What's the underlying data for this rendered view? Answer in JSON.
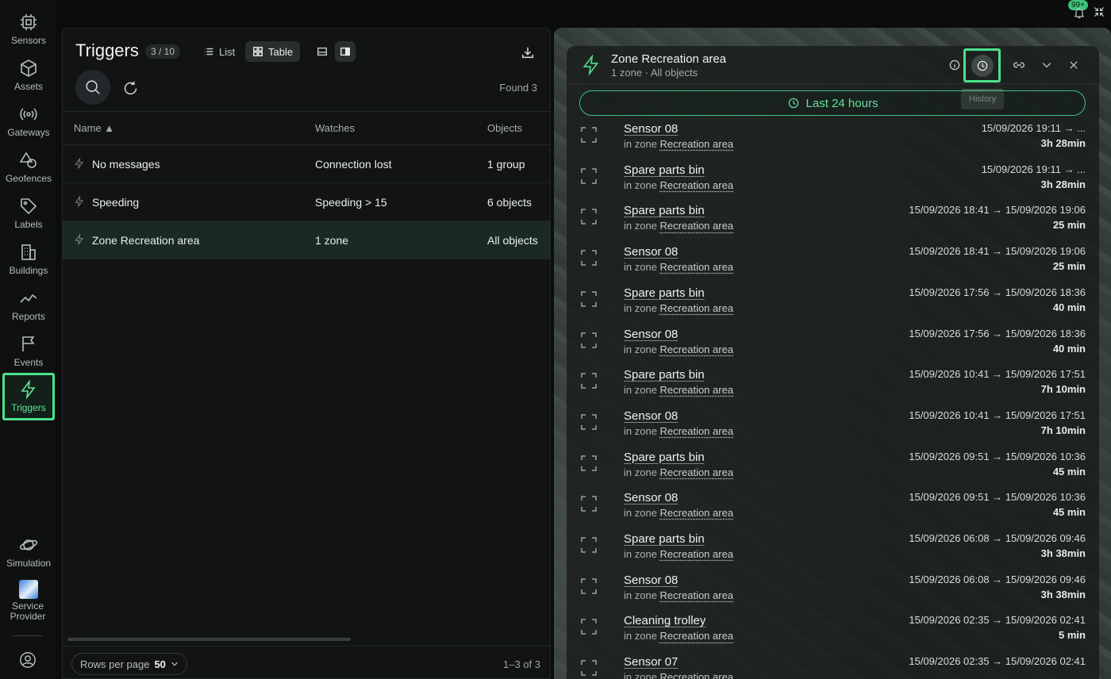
{
  "nav": {
    "items": [
      {
        "label": "Sensors",
        "icon": "chip-icon"
      },
      {
        "label": "Assets",
        "icon": "cube-icon"
      },
      {
        "label": "Gateways",
        "icon": "broadcast-icon"
      },
      {
        "label": "Geofences",
        "icon": "shapes-icon"
      },
      {
        "label": "Labels",
        "icon": "tag-icon"
      },
      {
        "label": "Buildings",
        "icon": "building-icon"
      },
      {
        "label": "Reports",
        "icon": "chart-line-icon"
      },
      {
        "label": "Events",
        "icon": "flag-icon"
      },
      {
        "label": "Triggers",
        "icon": "bolt-icon"
      }
    ],
    "bottom": [
      {
        "label": "Simulation",
        "icon": "planet-icon"
      },
      {
        "label": "Service Provider",
        "icon": "provider-logo-icon"
      }
    ],
    "notifications_badge": "99+"
  },
  "triggers": {
    "title": "Triggers",
    "count": "3 / 10",
    "view_list": "List",
    "view_table": "Table",
    "found": "Found 3",
    "columns": {
      "name": "Name ▲",
      "watches": "Watches",
      "objects": "Objects"
    },
    "rows": [
      {
        "name": "No messages",
        "watches": "Connection lost",
        "objects": "1 group"
      },
      {
        "name": "Speeding",
        "watches": "Speeding > 15",
        "objects": "6 objects"
      },
      {
        "name": "Zone Recreation area",
        "watches": "1 zone",
        "objects": "All objects"
      }
    ],
    "rows_per_page_label": "Rows per page",
    "rows_per_page_value": "50",
    "pager": "1–3 of 3"
  },
  "detail": {
    "title": "Zone Recreation area",
    "subtitle": "1 zone · All objects",
    "tooltip": "History",
    "range": "Last 24 hours",
    "zone_prefix": "in zone",
    "zone_name": "Recreation area",
    "events": [
      {
        "name": "Sensor 08",
        "time": "15/09/2026 19:11 → ...",
        "duration": "3h 28min"
      },
      {
        "name": "Spare parts bin",
        "time": "15/09/2026 19:11 → ...",
        "duration": "3h 28min"
      },
      {
        "name": "Spare parts bin",
        "time": "15/09/2026 18:41 → 15/09/2026 19:06",
        "duration": "25 min"
      },
      {
        "name": "Sensor 08",
        "time": "15/09/2026 18:41 → 15/09/2026 19:06",
        "duration": "25 min"
      },
      {
        "name": "Spare parts bin",
        "time": "15/09/2026 17:56 → 15/09/2026 18:36",
        "duration": "40 min"
      },
      {
        "name": "Sensor 08",
        "time": "15/09/2026 17:56 → 15/09/2026 18:36",
        "duration": "40 min"
      },
      {
        "name": "Spare parts bin",
        "time": "15/09/2026 10:41 → 15/09/2026 17:51",
        "duration": "7h 10min"
      },
      {
        "name": "Sensor 08",
        "time": "15/09/2026 10:41 → 15/09/2026 17:51",
        "duration": "7h 10min"
      },
      {
        "name": "Spare parts bin",
        "time": "15/09/2026 09:51 → 15/09/2026 10:36",
        "duration": "45 min"
      },
      {
        "name": "Sensor 08",
        "time": "15/09/2026 09:51 → 15/09/2026 10:36",
        "duration": "45 min"
      },
      {
        "name": "Spare parts bin",
        "time": "15/09/2026 06:08 → 15/09/2026 09:46",
        "duration": "3h 38min"
      },
      {
        "name": "Sensor 08",
        "time": "15/09/2026 06:08 → 15/09/2026 09:46",
        "duration": "3h 38min"
      },
      {
        "name": "Cleaning trolley",
        "time": "15/09/2026 02:35 → 15/09/2026 02:41",
        "duration": "5 min"
      },
      {
        "name": "Sensor 07",
        "time": "15/09/2026 02:35 → 15/09/2026 02:41",
        "duration": ""
      }
    ]
  },
  "colors": {
    "accent": "#4be28a",
    "background": "#0b0c0c"
  }
}
